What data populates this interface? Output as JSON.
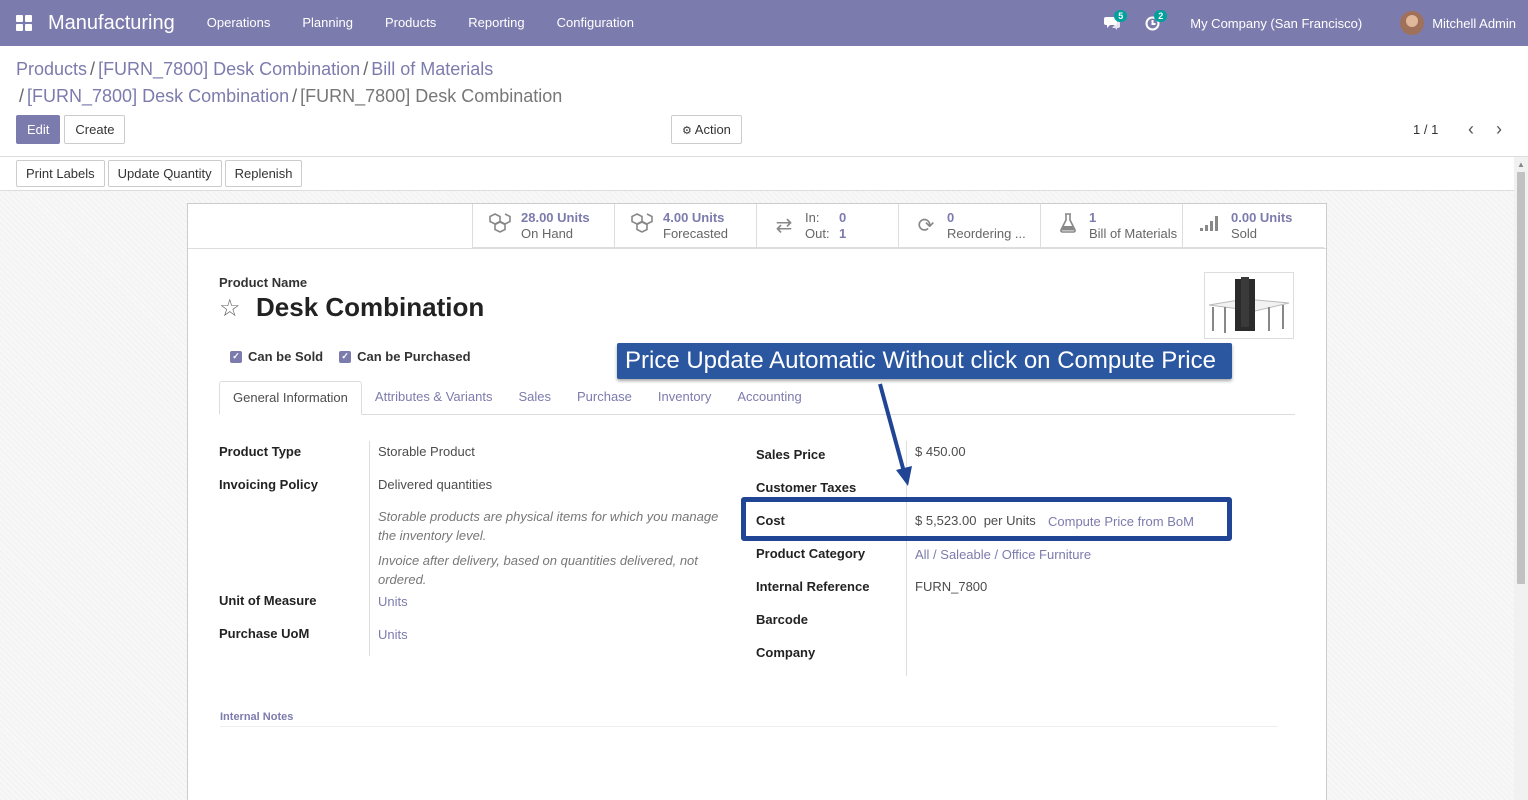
{
  "navbar": {
    "app_name": "Manufacturing",
    "menu": [
      "Operations",
      "Planning",
      "Products",
      "Reporting",
      "Configuration"
    ],
    "messages_count": "5",
    "activities_count": "2",
    "company": "My Company (San Francisco)",
    "user": "Mitchell Admin"
  },
  "breadcrumb": {
    "items": [
      "Products",
      "[FURN_7800] Desk Combination",
      "Bill of Materials",
      "[FURN_7800] Desk Combination"
    ],
    "active": "[FURN_7800] Desk Combination",
    "separator": "/"
  },
  "control_panel": {
    "edit_label": "Edit",
    "create_label": "Create",
    "action_label": "Action",
    "pager": "1 / 1"
  },
  "statusbar": {
    "buttons": [
      "Print Labels",
      "Update Quantity",
      "Replenish"
    ]
  },
  "smart_buttons": {
    "on_hand": {
      "value": "28.00 Units",
      "label": "On Hand"
    },
    "forecasted": {
      "value": "4.00 Units",
      "label": "Forecasted"
    },
    "in_out": {
      "in_label": "In:",
      "in_value": "0",
      "out_label": "Out:",
      "out_value": "1"
    },
    "reordering": {
      "value": "0",
      "label": "Reordering ..."
    },
    "bom": {
      "value": "1",
      "label": "Bill of Materials"
    },
    "sold": {
      "value": "0.00 Units",
      "label": "Sold"
    }
  },
  "product": {
    "name_label": "Product Name",
    "name": "Desk Combination",
    "can_be_sold": "Can be Sold",
    "can_be_purchased": "Can be Purchased"
  },
  "tabs": [
    "General Information",
    "Attributes & Variants",
    "Sales",
    "Purchase",
    "Inventory",
    "Accounting"
  ],
  "left_fields": {
    "product_type": {
      "label": "Product Type",
      "value": "Storable Product"
    },
    "invoicing_policy": {
      "label": "Invoicing Policy",
      "value": "Delivered quantities"
    },
    "help_storable": "Storable products are physical items for which you manage the inventory level.",
    "help_invoice": "Invoice after delivery, based on quantities delivered, not ordered.",
    "uom": {
      "label": "Unit of Measure",
      "value": "Units"
    },
    "purchase_uom": {
      "label": "Purchase UoM",
      "value": "Units"
    }
  },
  "right_fields": {
    "sales_price": {
      "label": "Sales Price",
      "value": "$ 450.00"
    },
    "customer_taxes": {
      "label": "Customer Taxes",
      "value": ""
    },
    "cost": {
      "label": "Cost",
      "value": "$ 5,523.00",
      "unit": "per Units",
      "compute_link": "Compute Price from BoM"
    },
    "product_category": {
      "label": "Product Category",
      "value": "All / Saleable / Office Furniture"
    },
    "internal_reference": {
      "label": "Internal Reference",
      "value": "FURN_7800"
    },
    "barcode": {
      "label": "Barcode",
      "value": ""
    },
    "company": {
      "label": "Company",
      "value": ""
    }
  },
  "notes": {
    "label": "Internal Notes"
  },
  "annotation": {
    "callout_text": "Price Update Automatic Without click on Compute Price",
    "color": "#2b56a0"
  },
  "theme": {
    "primary": "#7c7bad",
    "accent_badge": "#00a09d"
  }
}
